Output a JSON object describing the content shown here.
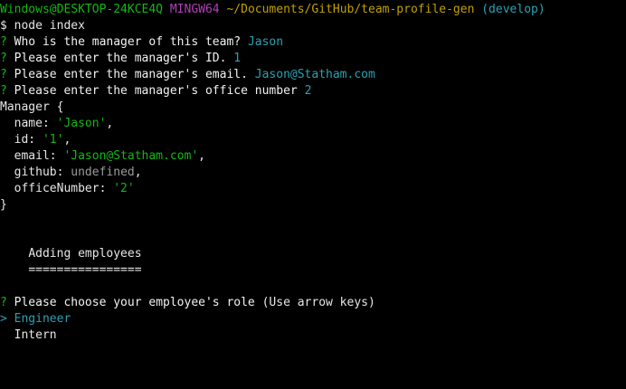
{
  "prompt": {
    "user_host": "Windows@DESKTOP-24KCE4Q",
    "shell": "MINGW64",
    "path": "~/Documents/GitHub/team-profile-gen",
    "branch": "(develop)",
    "symbol": "$",
    "command": "node index"
  },
  "questions": [
    {
      "mark": "?",
      "text": "Who is the manager of this team?",
      "answer": "Jason"
    },
    {
      "mark": "?",
      "text": "Please enter the manager's ID.",
      "answer": "1"
    },
    {
      "mark": "?",
      "text": "Please enter the manager's email.",
      "answer": "Jason@Statham.com"
    },
    {
      "mark": "?",
      "text": "Please enter the manager's office number",
      "answer": "2"
    }
  ],
  "manager": {
    "class_open": "Manager {",
    "close": "}",
    "fields": [
      {
        "key": "name:",
        "value": "'Jason'",
        "suffix": ","
      },
      {
        "key": "id:",
        "value": "'1'",
        "suffix": ","
      },
      {
        "key": "email:",
        "value": "'Jason@Statham.com'",
        "suffix": ","
      },
      {
        "key": "github:",
        "value": "undefined",
        "suffix": ","
      },
      {
        "key": "officeNumber:",
        "value": "'2'",
        "suffix": ""
      }
    ]
  },
  "section": {
    "title": "Adding employees",
    "underline": "================"
  },
  "role_prompt": {
    "mark": "?",
    "text": "Please choose your employee's role",
    "hint": "(Use arrow keys)",
    "pointer": ">",
    "options": [
      "Engineer",
      "Intern"
    ],
    "selected": "Engineer"
  },
  "colors": {
    "background": "#000000",
    "text": "#cccccc",
    "prompt_green": "#12b812",
    "prompt_magenta": "#b140b7",
    "prompt_yellow": "#c0a000",
    "answer_cyan": "#2aa1b3",
    "string_green": "#12b812",
    "undefined_gray": "#9a9a9a"
  }
}
